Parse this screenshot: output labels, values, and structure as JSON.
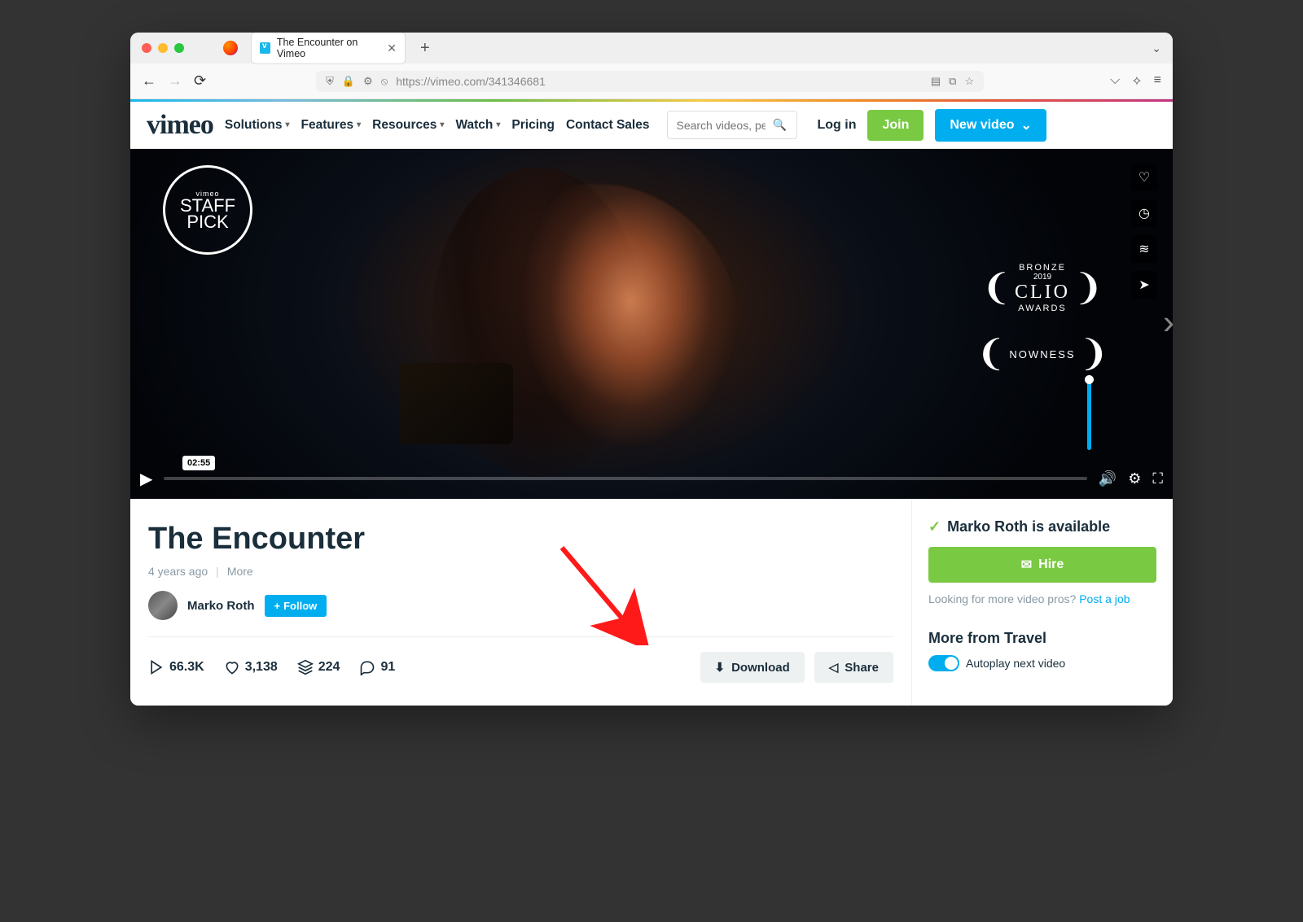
{
  "browser": {
    "tab_title": "The Encounter on Vimeo",
    "url": "https://vimeo.com/341346681"
  },
  "header": {
    "logo": "vimeo",
    "nav": [
      "Solutions",
      "Features",
      "Resources",
      "Watch",
      "Pricing",
      "Contact Sales"
    ],
    "search_placeholder": "Search videos, pe",
    "login": "Log in",
    "join": "Join",
    "new_video": "New video"
  },
  "player": {
    "staff_pick_top": "vimeo",
    "staff_pick_main": "STAFF\nPICK",
    "laurel1_top": "BRONZE",
    "laurel1_year": "2019",
    "laurel1_main": "CLIO",
    "laurel1_bottom": "AWARDS",
    "laurel2_main": "NOWNESS",
    "duration_tip": "02:55",
    "side_actions": [
      "like",
      "watch-later",
      "collections",
      "share"
    ]
  },
  "video": {
    "title": "The Encounter",
    "age": "4 years ago",
    "more": "More",
    "author": "Marko Roth",
    "follow": "Follow",
    "stats": {
      "plays": "66.3K",
      "likes": "3,138",
      "collections": "224",
      "comments": "91"
    },
    "download": "Download",
    "share": "Share"
  },
  "sidebar": {
    "available": "Marko Roth is available",
    "hire": "Hire",
    "looking_prefix": "Looking for more video pros? ",
    "looking_link": "Post a job",
    "more_from": "More from Travel",
    "autoplay": "Autoplay next video"
  }
}
